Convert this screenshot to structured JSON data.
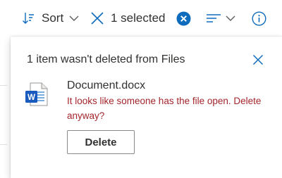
{
  "toolbar": {
    "sort_label": "Sort",
    "selection_label": "1 selected",
    "icons": {
      "sort": "sort-icon",
      "sort_chevron": "chevron-down-icon",
      "deselect": "close-icon",
      "clear_selection": "clear-selection-circle-icon",
      "view_options": "view-options-icon",
      "view_chevron": "chevron-down-icon",
      "info": "info-icon"
    }
  },
  "dialog": {
    "title": "1 item wasn't deleted from Files",
    "file_name": "Document.docx",
    "error_message": "It looks like someone has the file open. Delete anyway?",
    "delete_label": "Delete",
    "file_icon": "word-document-icon",
    "close_icon": "close-icon"
  },
  "colors": {
    "accent": "#0f6cbd",
    "error": "#a4262c",
    "text": "#323130",
    "word_blue": "#185abd"
  }
}
